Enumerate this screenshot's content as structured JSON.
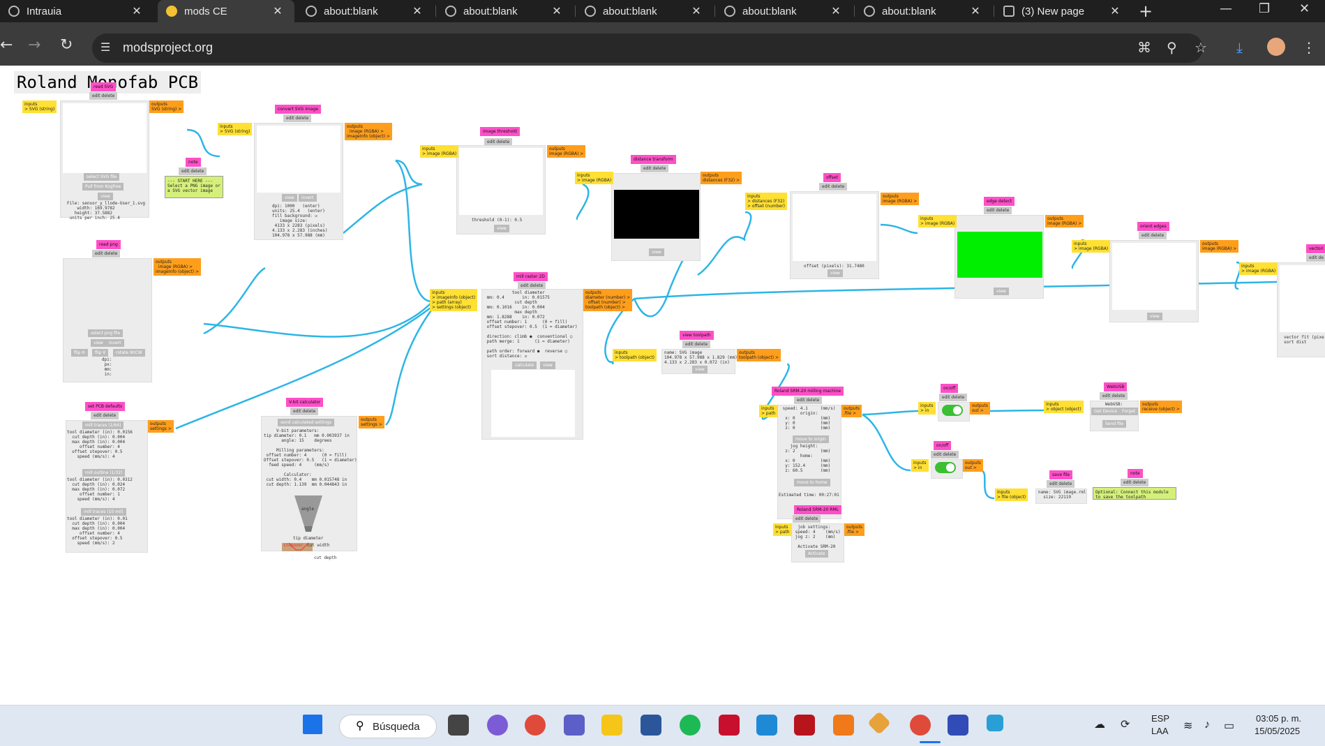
{
  "browser": {
    "tabs": [
      {
        "label": "Intrauia"
      },
      {
        "label": "mods CE"
      },
      {
        "label": "about:blank"
      },
      {
        "label": "about:blank"
      },
      {
        "label": "about:blank"
      },
      {
        "label": "about:blank"
      },
      {
        "label": "about:blank"
      },
      {
        "label": "(3) New page"
      }
    ],
    "url": "modsproject.org",
    "icons": [
      "back-icon",
      "forward-icon",
      "reload-icon",
      "site-settings-icon",
      "translate-icon",
      "zoom-icon",
      "bookmark-star-icon",
      "download-icon",
      "profile-avatar",
      "menu-icon"
    ]
  },
  "page": {
    "title": "Roland Monofab PCB"
  },
  "modules": {
    "read_svg": {
      "title": "read SVG",
      "ctl": "edit delete",
      "in": "inputs\n> SVG (string)",
      "out": "outputs\nSVG (string) >",
      "btn1": "select SVG file",
      "btn2": "Pull from Kogfree",
      "btn3": "view",
      "info": "File: sensor_y_llode-User_1.svg\n    width: 169.9782\n   height: 37.5882\n units per inch: 25.4"
    },
    "note1": {
      "title": "note",
      "ctl": "edit delete",
      "text": "--- START HERE ---\nSelect a PNG image or\na SVG vector image"
    },
    "convert_svg": {
      "title": "convert SVG image",
      "ctl": "edit delete",
      "in": "inputs\n> SVG (string)",
      "out": "outputs\n  image (RGBA) >\nimageInfo (object) >",
      "btn1": "view",
      "btn2": "invert",
      "info": "dpi: 1000   (enter)\nunits: 25.4   (enter)\nfill background: ☑\n   image size:\n 4133 x 2283 (pixels)\n4.133 x 2.283 (inches)\n104.978 x 57.988 (mm)"
    },
    "image_threshold": {
      "title": "image threshold",
      "ctl": "edit delete",
      "in": "inputs\n> image (RGBA)",
      "out": "outputs\nimage (RGBA) >",
      "info": "threshold (0-1): 0.5",
      "btn1": "view"
    },
    "distance_transform": {
      "title": "distance transform",
      "ctl": "edit delete",
      "in": "inputs\n> image (RGBA)",
      "out": "outputs\ndistances (F32) >",
      "btn1": "view"
    },
    "offset": {
      "title": "offset",
      "ctl": "edit delete",
      "in": "inputs\n> distances (F32)\n> offset (number)",
      "out": "outputs\nimage (RGBA) >",
      "info": "offset (pixels): 31.7480",
      "btn1": "view"
    },
    "edge_detect": {
      "title": "edge detect",
      "ctl": "edit delete",
      "in": "inputs\n> image (RGBA)",
      "out": "outputs\nimage (RGBA) >",
      "btn1": "view"
    },
    "orient_edges": {
      "title": "orient edges",
      "ctl": "edit delete",
      "in": "inputs\n> image (RGBA)",
      "out": "outputs\nimage (RGBA) >",
      "btn1": "view"
    },
    "vectorize": {
      "title": "vectori",
      "ctl": "edit de",
      "in": "inputs\n> image (RGBA)",
      "info": "vector fit (pixe\nsort dist"
    },
    "read_png": {
      "title": "read png",
      "ctl": "edit delete",
      "out": "outputs\n  image (RGBA) >\nimageInfo (object) >",
      "btn1": "select png file",
      "btn2": "view",
      "btn3": "invert",
      "btn4": "flip H",
      "btn5": "flip V",
      "btn6": "rotate 90CW",
      "info": "dpi:\n px:\n mm:\n in:"
    },
    "mill_raster": {
      "title": "mill raster 2D",
      "ctl": "edit delete",
      "in": "inputs\n> imageInfo (object)\n> path (array)\n> settings (object)",
      "out": "outputs\ndiameter (number) >\n  offset (number) >\ntoolpath (object) >",
      "info": "           tool diameter\n mm: 0.4       in: 0.01575\n            cut depth\n mm: 0.1016    in: 0.004\n            max depth\n mm: 1.8288    in: 0.072\n offset number: 1      (0 = fill)\n offset stepover: 0.5  (1 = diameter)\n\n direction: climb ●  conventional ○\n path merge: 1      (1 = diameter)\n\n path order: forward ●  reverse ○\n sort distance: ☑",
      "btn1": "calculate",
      "btn2": "view"
    },
    "view_toolpath": {
      "title": "view toolpath",
      "ctl": "edit delete",
      "in": "inputs\n> toolpath (object)",
      "out": "outputs\ntoolpath (object) >",
      "info": "name: SVG image\n104.978 x 57.988 x 1.829 (mm)\n4.133 x 2.283 x 0.072 (in)",
      "btn1": "view"
    },
    "set_pcb": {
      "title": "set PCB defaults",
      "ctl": "edit delete",
      "out": "outputs\nsettings >",
      "b1": "mill traces (1/64)",
      "t1": "tool diameter (in): 0.0156\n  cut depth (in): 0.004\n  max depth (in): 0.004\n     offset number: 4\n  offset stepover: 0.5\n    speed (mm/s): 4",
      "b2": "mill outline (1/32)",
      "t2": "tool diameter (in): 0.0312\n  cut depth (in): 0.024\n  max depth (in): 0.072\n     offset number: 1\n    speed (mm/s): 4",
      "b3": "mill traces (10 mil)",
      "t3": "tool diameter (in): 0.01\n  cut depth (in): 0.004\n  max depth (in): 0.004\n     offset number: 4\n  offset stepover: 0.5\n    speed (mm/s): 2"
    },
    "vbit": {
      "title": "V-bit calculator",
      "ctl": "edit delete",
      "out": "outputs\nsettings >",
      "btn1": "send calculated settings",
      "info": "     V-bit parameters:\ntip diameter: 0.1   mm 0.003937 in\n       angle: 15    degrees\n\n     Milling parameters:\n offset number: 4      (0 = fill)\nOffset stepover: 0.5   (1 = diameter)\n  feed speed: 4     (mm/s)\n\n        Calculator:\n cut width: 0.4    mm 0.015748 in\n cut depth: 1.139  mm 0.044843 in",
      "angle": "angle",
      "tip": "tip diameter",
      "stepover": "stepover",
      "cutwidth": "cut width",
      "cutdepth": "cut depth"
    },
    "roland_milling": {
      "title": "Roland SRM-20 milling machine",
      "ctl": "edit delete",
      "in": "inputs\n> path",
      "out": "outputs\n.file >",
      "info": " speed: 4.1     (mm/s)\n        origin:\n  x: 0          (mm)\n  y: 0          (mm)\n  z: 0          (mm)",
      "btn1": "move to origin",
      "info2": "    jog height:\n  z: 2          (mm)\n        home:\n  x: 0          (mm)\n  y: 152.4      (mm)\n  z: 60.5       (mm)",
      "btn2": "move to home",
      "est": "Estimated time: 00:27:01"
    },
    "roland_rml": {
      "title": "Roland SRM-20 RML",
      "ctl": "edit delete",
      "in": "inputs\n> path",
      "out": "outputs\n.file >",
      "info": "  job settings:\n speed: 4    (mm/s)\n jog z: 2    (mm)\n\n  Activate SRM-20",
      "btn1": "Activate"
    },
    "onoff1": {
      "title": "on/off",
      "ctl": "edit delete",
      "in": "inputs\n> in",
      "out": "outputs\nout >"
    },
    "onoff2": {
      "title": "on/off",
      "ctl": "edit delete",
      "in": "inputs\n> in",
      "out": "outputs\nout >"
    },
    "websub": {
      "title": "WebUSB",
      "ctl": "edit delete",
      "in": "inputs\n> object (object)",
      "out": "outputs\nreceive (object) >",
      "btn1": "Get Device",
      "btn2": "Forget",
      "btn3": "Send file",
      "label": "WebUSB:"
    },
    "save_file": {
      "title": "save file",
      "ctl": "edit delete",
      "in": "inputs\n> file (object)",
      "info": "name: SVG image.rml\n  size: 22119"
    },
    "note2": {
      "title": "note",
      "ctl": "edit delete",
      "text": "Optional: Connect this module\nto save the toolpath"
    }
  },
  "taskbar": {
    "search_label": "Búsqueda",
    "lang1": "ESP",
    "lang2": "LAA",
    "time": "03:05 p. m.",
    "date": "15/05/2025",
    "apps": [
      "windows-start-icon",
      "search-icon",
      "files-icon",
      "copilot-icon",
      "chrome-icon",
      "teams-icon",
      "explorer-icon",
      "word-icon",
      "spotify-icon",
      "autocad-icon",
      "vscode-icon",
      "solidworks-icon",
      "fusion-icon",
      "app-icon",
      "chrome-active-icon",
      "kicad-icon",
      "snipping-icon"
    ]
  },
  "colors": {
    "title_pink": "#ff4fc8",
    "input_yellow": "#ffe033",
    "output_orange": "#ff9e1b",
    "wire_blue": "#2cb5e6",
    "edge_green": "#00ee00"
  }
}
